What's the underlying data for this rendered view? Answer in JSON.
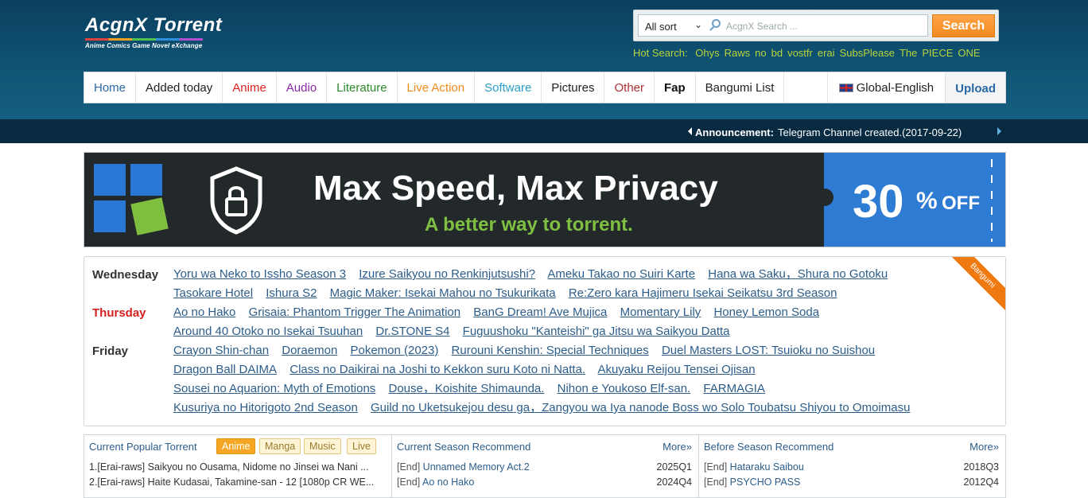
{
  "header": {
    "logo_name": "AcgnX Torrent",
    "logo_tagline": "Anime Comics Game Novel eXchange",
    "search": {
      "sort_selected": "All sort",
      "placeholder": "AcgnX Search ...",
      "button_label": "Search"
    },
    "hot_search_label": "Hot Search:",
    "hot_terms": [
      "Ohys",
      "Raws",
      "no",
      "bd",
      "vostfr",
      "erai",
      "SubsPlease",
      "The",
      "PIECE",
      "ONE"
    ]
  },
  "nav": {
    "items": [
      {
        "label": "Home",
        "color": "#2b67a3"
      },
      {
        "label": "Added today",
        "color": "#222222"
      },
      {
        "label": "Anime",
        "color": "#e02020"
      },
      {
        "label": "Audio",
        "color": "#8a2aa8"
      },
      {
        "label": "Literature",
        "color": "#2a8a2a"
      },
      {
        "label": "Live Action",
        "color": "#f08a1a"
      },
      {
        "label": "Software",
        "color": "#2aa0c8"
      },
      {
        "label": "Pictures",
        "color": "#222222"
      },
      {
        "label": "Other",
        "color": "#b03030"
      },
      {
        "label": "Fap",
        "color": "#111111"
      },
      {
        "label": "Bangumi List",
        "color": "#222222"
      }
    ],
    "language": "Global-English",
    "upload": "Upload"
  },
  "announcement": {
    "label": "Announcement:",
    "text": "Telegram Channel created.(2017-09-22)"
  },
  "banner": {
    "headline": "Max Speed, Max Privacy",
    "subline": "A better way to torrent.",
    "discount_number": "30",
    "discount_pct": "%",
    "discount_off": "OFF"
  },
  "schedule": {
    "ribbon": "Bangumi",
    "days": [
      {
        "day": "Wednesday",
        "today": false,
        "titles": [
          "Yoru wa Neko to Issho Season 3",
          "Izure Saikyou no Renkinjutsushi?",
          "Ameku Takao no Suiri Karte",
          "Hana wa Saku，Shura no Gotoku",
          "Tasokare Hotel",
          "Ishura S2",
          "Magic Maker: Isekai Mahou no Tsukurikata",
          "Re:Zero kara Hajimeru Isekai Seikatsu 3rd Season"
        ]
      },
      {
        "day": "Thursday",
        "today": true,
        "titles": [
          "Ao no Hako",
          "Grisaia: Phantom Trigger The Animation",
          "BanG Dream! Ave Mujica",
          "Momentary Lily",
          "Honey Lemon Soda",
          "Around 40 Otoko no Isekai Tsuuhan",
          "Dr.STONE S4",
          "Fuguushoku \"Kanteishi\" ga Jitsu wa Saikyou Datta"
        ]
      },
      {
        "day": "Friday",
        "today": false,
        "titles": [
          "Crayon Shin-chan",
          "Doraemon",
          "Pokemon (2023)",
          "Rurouni Kenshin: Special Techniques",
          "Duel Masters LOST: Tsuioku no Suishou",
          "Dragon Ball DAIMA",
          "Class no Daikirai na Joshi to Kekkon suru Koto ni Natta.",
          "Akuyaku Reijou Tensei Ojisan",
          "Sousei no Aquarion: Myth of Emotions",
          "Douse，Koishite Shimaunda.",
          "Nihon e Youkoso Elf-san.",
          "FARMAGIA",
          "Kusuriya no Hitorigoto 2nd Season",
          "Guild no Uketsukejou desu ga，Zangyou wa Iya nanode Boss wo Solo Toubatsu Shiyou to Omoimasu"
        ]
      }
    ]
  },
  "panels": {
    "popular": {
      "title": "Current Popular Torrent",
      "tabs": [
        "Anime",
        "Manga",
        "Music",
        "Live"
      ],
      "rows": [
        "1.[Erai-raws] Saikyou no Ousama, Nidome no Jinsei wa Nani ...",
        "2.[Erai-raws] Haite Kudasai, Takamine-san - 12 [1080p CR WE..."
      ]
    },
    "current_season": {
      "title": "Current Season Recommend",
      "more": "More»",
      "rows": [
        {
          "tag": "[End]",
          "title": "Unnamed Memory Act.2",
          "season": "2025Q1"
        },
        {
          "tag": "[End]",
          "title": "Ao no Hako",
          "season": "2024Q4"
        }
      ]
    },
    "before_season": {
      "title": "Before Season Recommend",
      "more": "More»",
      "rows": [
        {
          "tag": "[End]",
          "title": "Hataraku Saibou",
          "season": "2018Q3"
        },
        {
          "tag": "[End]",
          "title": "PSYCHO PASS",
          "season": "2012Q4"
        }
      ]
    }
  }
}
